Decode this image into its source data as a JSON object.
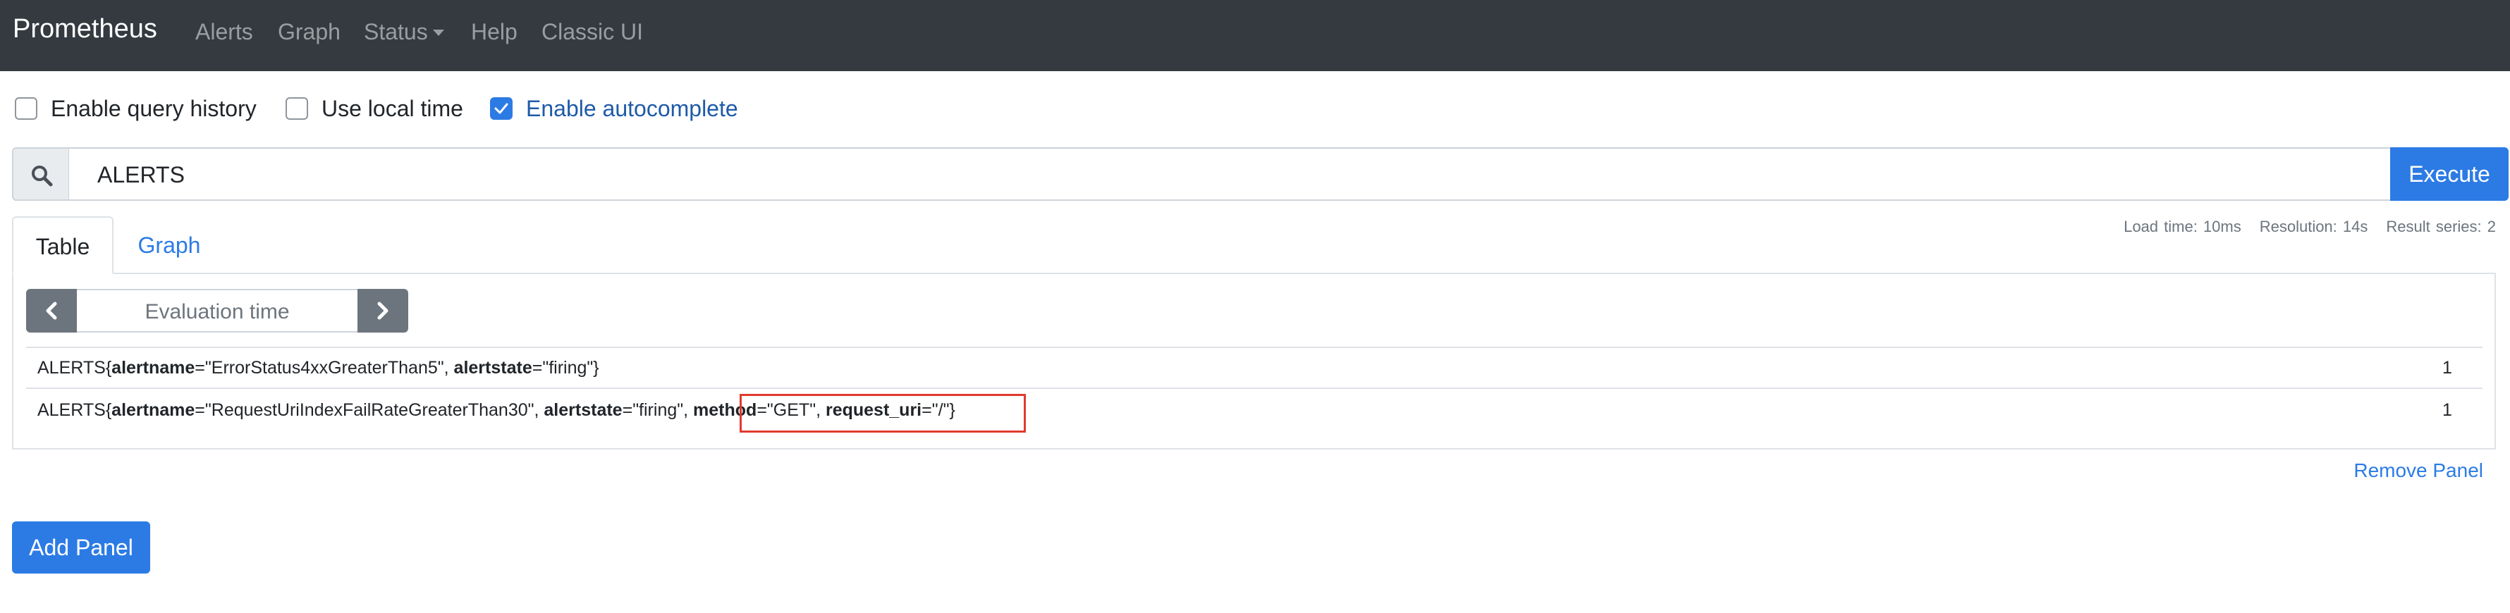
{
  "navbar": {
    "brand": "Prometheus",
    "items": [
      {
        "label": "Alerts"
      },
      {
        "label": "Graph"
      },
      {
        "label": "Status"
      },
      {
        "label": "Help"
      },
      {
        "label": "Classic UI"
      }
    ]
  },
  "options": {
    "query_history": {
      "label": "Enable query history",
      "checked": false
    },
    "local_time": {
      "label": "Use local time",
      "checked": false
    },
    "autocomplete": {
      "label": "Enable autocomplete",
      "checked": true
    }
  },
  "query": {
    "value": "ALERTS",
    "execute_label": "Execute"
  },
  "stats": {
    "load_time": "Load time: 10ms",
    "resolution": "Resolution: 14s",
    "result_series": "Result series: 2"
  },
  "tabs": [
    {
      "label": "Table",
      "active": true
    },
    {
      "label": "Graph",
      "active": false
    }
  ],
  "eval_time": {
    "placeholder": "Evaluation time"
  },
  "results": [
    {
      "metric": "ALERTS",
      "labels": [
        {
          "name": "alertname",
          "value": "\"ErrorStatus4xxGreaterThan5\""
        },
        {
          "name": "alertstate",
          "value": "\"firing\""
        }
      ],
      "value": "1"
    },
    {
      "metric": "ALERTS",
      "labels": [
        {
          "name": "alertname",
          "value": "\"RequestUriIndexFailRateGreaterThan30\""
        },
        {
          "name": "alertstate",
          "value": "\"firing\""
        },
        {
          "name": "method",
          "value": "\"GET\""
        },
        {
          "name": "request_uri",
          "value": "\"/\""
        }
      ],
      "value": "1"
    }
  ],
  "punct": {
    "open": "{",
    "close": "}",
    "eq": "=",
    "sep": ", "
  },
  "remove_panel": "Remove Panel",
  "add_panel": "Add Panel",
  "colors": {
    "navbar_bg": "#343a40",
    "primary": "#2c7be5",
    "secondary": "#6c757d",
    "highlight": "#e03a2f"
  }
}
